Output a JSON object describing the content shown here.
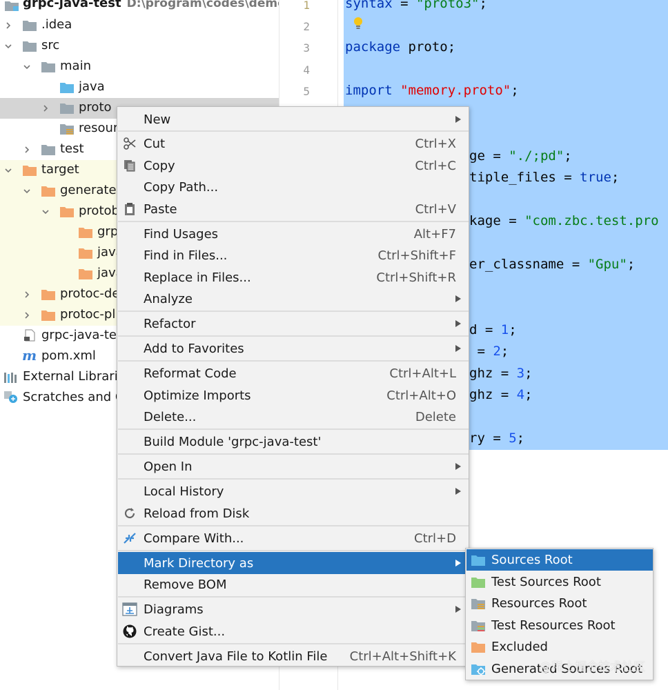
{
  "project_tree": {
    "root_name": "grpc-java-test",
    "root_path": "D:\\program\\codes\\demo\\g",
    "items": [
      {
        "label": "grpc-java-test"
      },
      {
        "label": ".idea"
      },
      {
        "label": "src"
      },
      {
        "label": "main"
      },
      {
        "label": "java"
      },
      {
        "label": "proto"
      },
      {
        "label": "resour"
      },
      {
        "label": "test"
      },
      {
        "label": "target"
      },
      {
        "label": "generated"
      },
      {
        "label": "protob"
      },
      {
        "label": "grp"
      },
      {
        "label": "java"
      },
      {
        "label": "java"
      },
      {
        "label": "protoc-de"
      },
      {
        "label": "protoc-pl"
      },
      {
        "label": "grpc-java-tes"
      },
      {
        "label": "pom.xml"
      },
      {
        "label": "External Librarie"
      },
      {
        "label": "Scratches and C"
      }
    ]
  },
  "editor": {
    "line_numbers": [
      "1",
      "2",
      "3",
      "4",
      "5"
    ],
    "code": {
      "l1_kw": "syntax",
      "l1_eq": " = ",
      "l1_str": "\"proto3\"",
      "l1_end": ";",
      "l3_kw": "package",
      "l3_rest": " proto;",
      "l5_kw": "import",
      "l5_sp": " ",
      "l5_str": "\"memory.proto\"",
      "l5_end": ";",
      "l8_a": "ge = ",
      "l8_str": "\"./;pd\"",
      "l8_end": ";",
      "l9_a": "tiple_files = ",
      "l9_kw": "true",
      "l9_end": ";",
      "l11_a": "kage = ",
      "l11_str": "\"com.zbc.test.pro",
      "l13_a": "er_classname = ",
      "l13_str": "\"Gpu\"",
      "l13_end": ";",
      "l16_a": "d = ",
      "l16_num": "1",
      "l16_end": ";",
      "l17_a": " = ",
      "l17_num": "2",
      "l17_end": ";",
      "l18_a": "ghz = ",
      "l18_num": "3",
      "l18_end": ";",
      "l19_a": "ghz = ",
      "l19_num": "4",
      "l19_end": ";",
      "l21_a": "ry = ",
      "l21_num": "5",
      "l21_end": ";"
    }
  },
  "context_menu": {
    "items": [
      {
        "label": "New",
        "shortcut": "",
        "submenu": true
      },
      {
        "label": "Cut",
        "shortcut": "Ctrl+X"
      },
      {
        "label": "Copy",
        "shortcut": "Ctrl+C"
      },
      {
        "label": "Copy Path...",
        "shortcut": ""
      },
      {
        "label": "Paste",
        "shortcut": "Ctrl+V"
      },
      {
        "label": "Find Usages",
        "shortcut": "Alt+F7"
      },
      {
        "label": "Find in Files...",
        "shortcut": "Ctrl+Shift+F"
      },
      {
        "label": "Replace in Files...",
        "shortcut": "Ctrl+Shift+R"
      },
      {
        "label": "Analyze",
        "shortcut": "",
        "submenu": true
      },
      {
        "label": "Refactor",
        "shortcut": "",
        "submenu": true
      },
      {
        "label": "Add to Favorites",
        "shortcut": "",
        "submenu": true
      },
      {
        "label": "Reformat Code",
        "shortcut": "Ctrl+Alt+L"
      },
      {
        "label": "Optimize Imports",
        "shortcut": "Ctrl+Alt+O"
      },
      {
        "label": "Delete...",
        "shortcut": "Delete"
      },
      {
        "label": "Build Module 'grpc-java-test'",
        "shortcut": ""
      },
      {
        "label": "Open In",
        "shortcut": "",
        "submenu": true
      },
      {
        "label": "Local History",
        "shortcut": "",
        "submenu": true
      },
      {
        "label": "Reload from Disk",
        "shortcut": ""
      },
      {
        "label": "Compare With...",
        "shortcut": "Ctrl+D"
      },
      {
        "label": "Mark Directory as",
        "shortcut": "",
        "submenu": true,
        "highlighted": true
      },
      {
        "label": "Remove BOM",
        "shortcut": ""
      },
      {
        "label": "Diagrams",
        "shortcut": "",
        "submenu": true
      },
      {
        "label": "Create Gist...",
        "shortcut": ""
      },
      {
        "label": "Convert Java File to Kotlin File",
        "shortcut": "Ctrl+Alt+Shift+K"
      }
    ]
  },
  "mark_directory_submenu": {
    "items": [
      {
        "label": "Sources Root",
        "highlighted": true
      },
      {
        "label": "Test Sources Root"
      },
      {
        "label": "Resources Root"
      },
      {
        "label": "Test Resources Root"
      },
      {
        "label": "Excluded"
      },
      {
        "label": "Generated Sources Root"
      }
    ]
  },
  "watermark": "@稀土掘金技术社区",
  "colors": {
    "selection_blue": "#2675bf",
    "editor_selection": "#a6d2ff",
    "folder_gray": "#9aa7b0",
    "folder_orange": "#f4a66b",
    "folder_blue": "#5fb8e8",
    "keyword": "#0033b3",
    "string": "#067d17",
    "number": "#1750eb"
  }
}
